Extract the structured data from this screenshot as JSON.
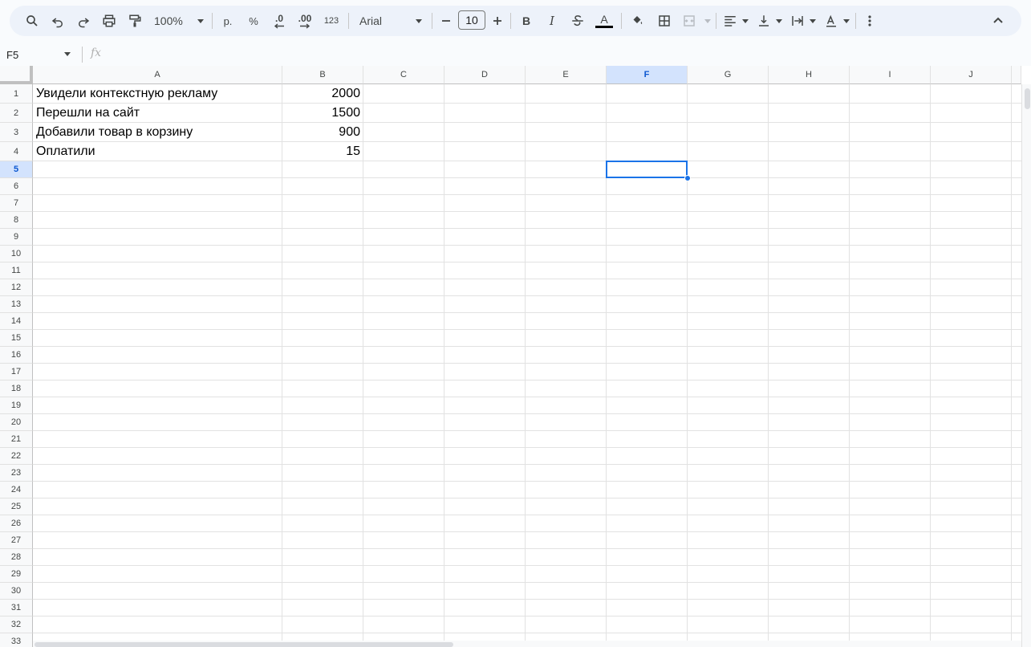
{
  "toolbar": {
    "zoom": "100%",
    "currency_label": "р.",
    "percent_label": "%",
    "dec_decrease_label": ".0",
    "dec_increase_label": ".00",
    "format_label": "123",
    "font_name": "Arial",
    "font_size": "10",
    "bold_label": "B",
    "italic_label": "I",
    "text_color_label": "A",
    "accent_color": "#1a73e8"
  },
  "formula_bar": {
    "name_box": "F5",
    "fx_label": "fx",
    "formula": ""
  },
  "sheet": {
    "columns": [
      "A",
      "B",
      "C",
      "D",
      "E",
      "F",
      "G",
      "H",
      "I",
      "J"
    ],
    "selected_column": "F",
    "selected_row": "5",
    "rows": [
      "1",
      "2",
      "3",
      "4",
      "5",
      "6",
      "7",
      "8",
      "9",
      "10",
      "11",
      "12",
      "13",
      "14",
      "15",
      "16",
      "17",
      "18",
      "19",
      "20",
      "21",
      "22",
      "23",
      "24",
      "25",
      "26",
      "27",
      "28",
      "29",
      "30",
      "31",
      "32",
      "33"
    ],
    "data": [
      {
        "a": "Увидели контекстную рекламу",
        "b": "2000"
      },
      {
        "a": "Перешли на сайт",
        "b": "1500"
      },
      {
        "a": "Добавили товар в корзину",
        "b": "900"
      },
      {
        "a": "Оплатили",
        "b": "15"
      }
    ]
  }
}
